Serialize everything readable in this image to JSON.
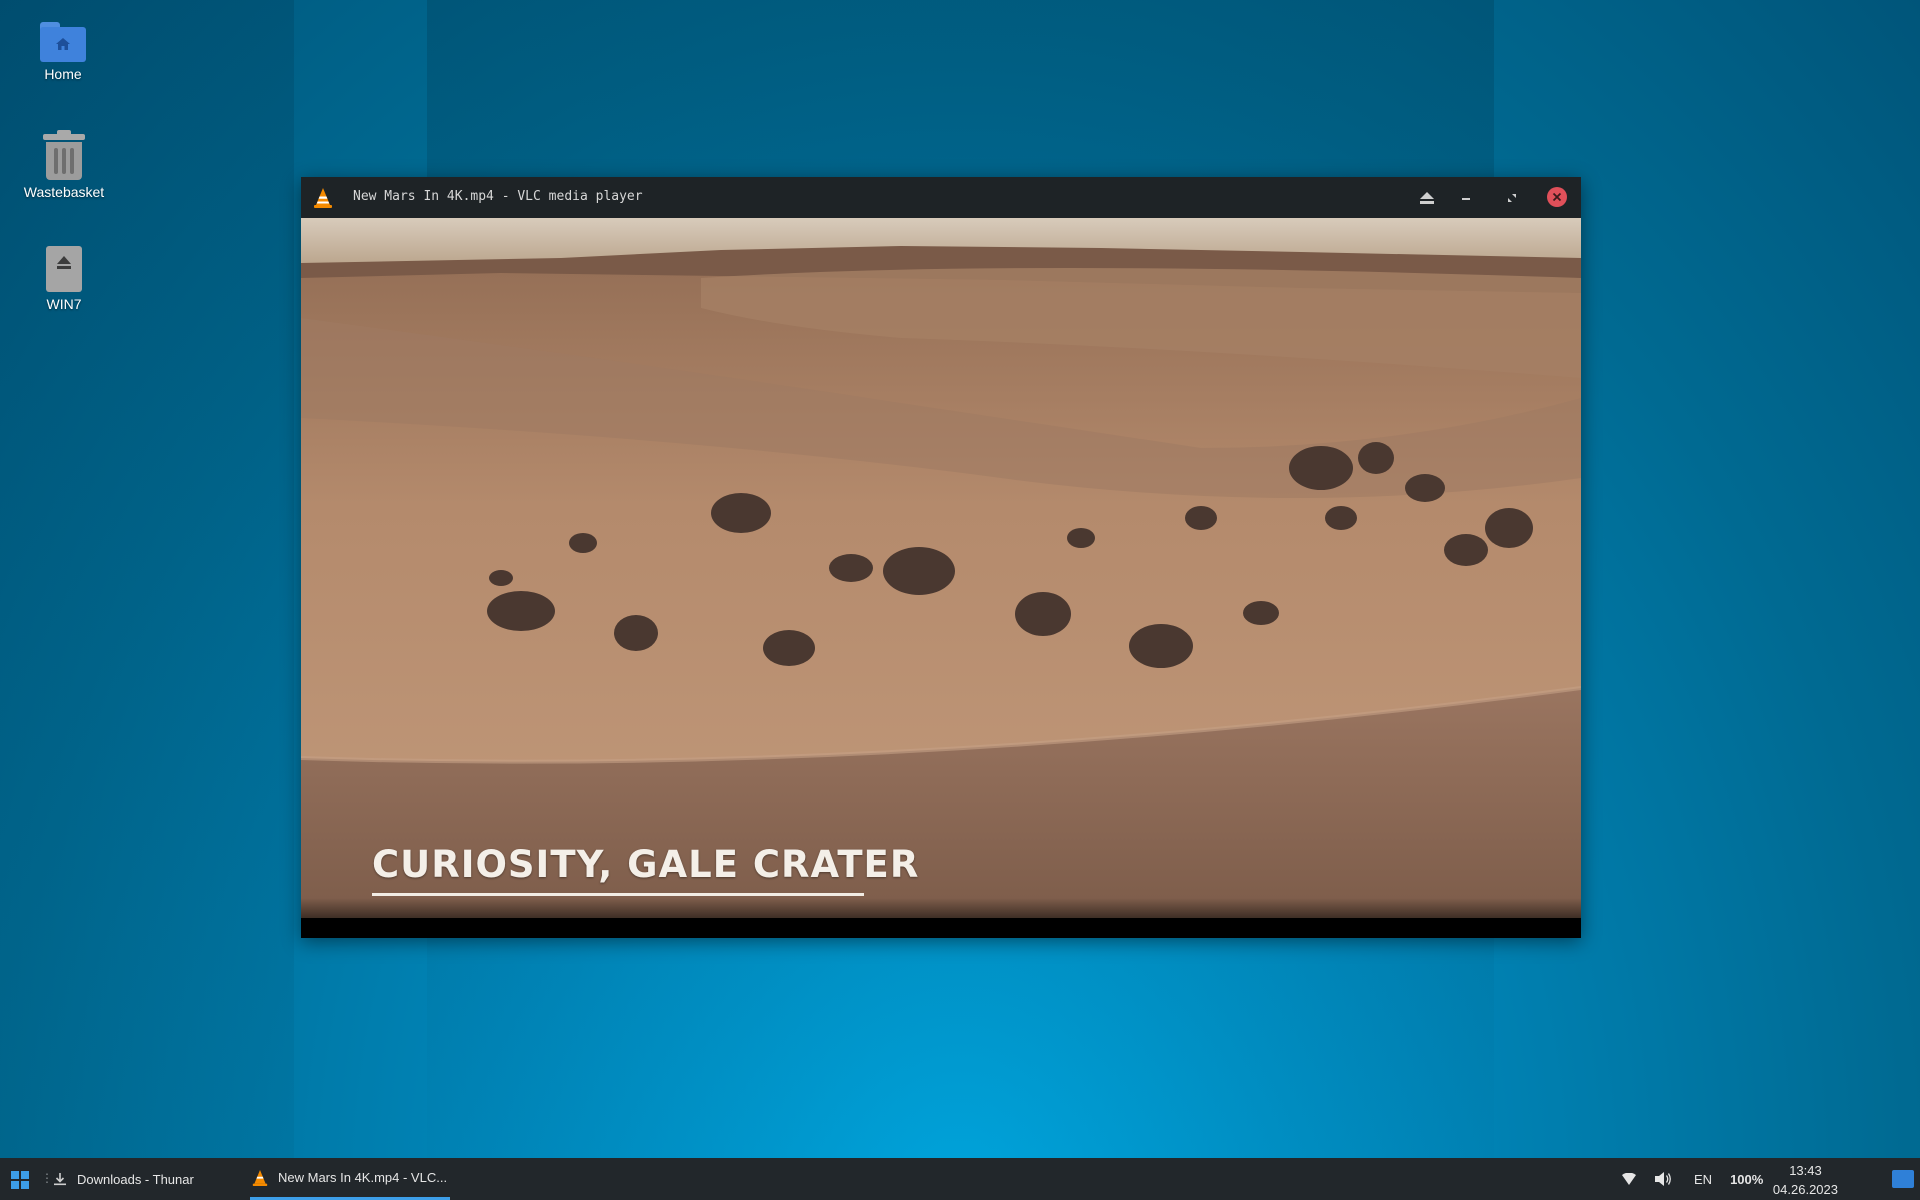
{
  "desktop": {
    "icons": [
      {
        "label": "Home",
        "icon": "home-folder-icon"
      },
      {
        "label": "Wastebasket",
        "icon": "trash-icon"
      },
      {
        "label": "WIN7",
        "icon": "removable-drive-icon"
      }
    ]
  },
  "vlc": {
    "title": "New Mars In 4K.mp4 - VLC media player",
    "video_caption": "CURIOSITY, GALE CRATER",
    "titlebar_buttons": [
      "eject-icon",
      "minimize-icon",
      "maximize-icon",
      "close-icon"
    ],
    "accent_colors": {
      "close": "#e0505a",
      "cone": "#f48a00"
    }
  },
  "taskbar": {
    "items": [
      {
        "label": "Downloads - Thunar",
        "icon": "download-icon",
        "active": false
      },
      {
        "label": "New Mars In 4K.mp4 - VLC...",
        "icon": "vlc-cone-icon",
        "active": true
      }
    ],
    "tray": {
      "language": "EN",
      "battery": "100%",
      "time": "13:43",
      "date": "04.26.2023"
    },
    "accent": "#3d9ee8"
  }
}
